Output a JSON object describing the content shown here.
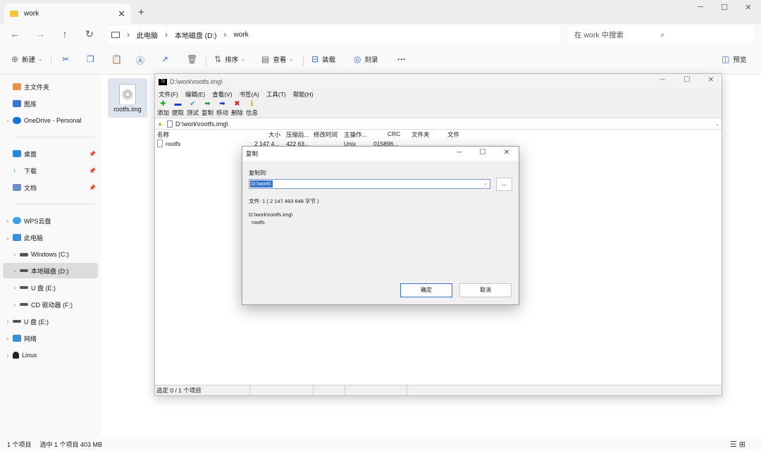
{
  "explorer": {
    "tab_title": "work",
    "breadcrumb": [
      "此电脑",
      "本地磁盘 (D:)",
      "work"
    ],
    "search_placeholder": "在 work 中搜索",
    "toolbar": {
      "new": "新建",
      "sort": "排序",
      "view": "查看",
      "mount": "装载",
      "burn": "刻录",
      "more": "···",
      "preview": "预览"
    },
    "nav": {
      "home": "主文件夹",
      "gallery": "图库",
      "onedrive": "OneDrive - Personal",
      "desktop": "桌面",
      "downloads": "下载",
      "documents": "文档",
      "wps": "WPS云盘",
      "this_pc": "此电脑",
      "windows_c": "Windows (C:)",
      "local_d": "本地磁盘 (D:)",
      "usb_e": "U 盘 (E:)",
      "cd_f": "CD 驱动器 (F:)",
      "usb_e2": "U 盘 (E:)",
      "network": "网络",
      "linux": "Linux"
    },
    "file_name": "rootfs.img",
    "status": {
      "count": "1 个项目",
      "selected": "选中 1 个项目 403 MB"
    }
  },
  "zip": {
    "title": "D:\\work\\rootfs.img\\",
    "menu": [
      "文件(F)",
      "编辑(E)",
      "查看(V)",
      "书签(A)",
      "工具(T)",
      "帮助(H)"
    ],
    "tools": [
      {
        "label": "添加",
        "icon": "✚",
        "color": "#1f9e1f"
      },
      {
        "label": "提取",
        "icon": "▬",
        "color": "#2340c9"
      },
      {
        "label": "测试",
        "icon": "✔",
        "color": "#1fb3b3"
      },
      {
        "label": "复制",
        "icon": "➡",
        "color": "#1f9e4a"
      },
      {
        "label": "移动",
        "icon": "➡",
        "color": "#2340c9"
      },
      {
        "label": "删除",
        "icon": "✖",
        "color": "#d42020"
      },
      {
        "label": "信息",
        "icon": "ℹ",
        "color": "#c9a200"
      }
    ],
    "path": "D:\\work\\rootfs.img\\",
    "columns": {
      "name": "名称",
      "size": "大小",
      "packed": "压缩后...",
      "modified": "修改时间",
      "host": "主操作...",
      "crc": "CRC",
      "folders": "文件夹",
      "files": "文件"
    },
    "row": {
      "name": "rootfs",
      "size": "2 147 4...",
      "packed": "422 63...",
      "host": "Unix",
      "crc": "015896..."
    },
    "status": "选定 0 / 1 个项目"
  },
  "dialog": {
    "title": "复制",
    "copy_to_label": "复制到:",
    "dest_value": "D:\\work\\",
    "browse": "...",
    "files_info": "文件: 1   ( 2 147 483 648 字节 )",
    "source_path": "D:\\work\\rootfs.img\\",
    "source_name": "rootfs",
    "ok": "确定",
    "cancel": "取消"
  }
}
